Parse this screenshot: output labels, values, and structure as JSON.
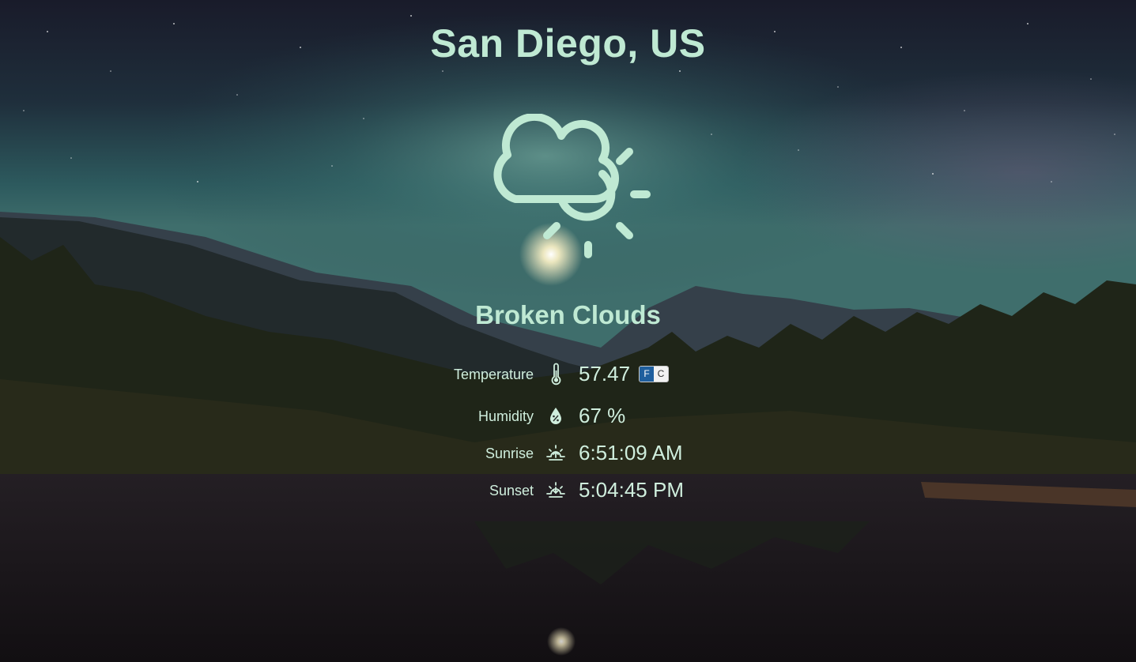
{
  "location": {
    "city_label": "San Diego, US"
  },
  "condition": {
    "label": "Broken Clouds",
    "icon": "cloud-sun-icon"
  },
  "colors": {
    "accent": "#bfe9d3",
    "toggle_active": "#1f5f9e",
    "toggle_inactive": "#f2f2f2"
  },
  "stats": {
    "temperature": {
      "label": "Temperature",
      "value": "57.47",
      "icon": "thermometer-icon"
    },
    "humidity": {
      "label": "Humidity",
      "value": "67 %",
      "icon": "humidity-icon"
    },
    "sunrise": {
      "label": "Sunrise",
      "value": "6:51:09 AM",
      "icon": "sunrise-icon"
    },
    "sunset": {
      "label": "Sunset",
      "value": "5:04:45 PM",
      "icon": "sunset-icon"
    }
  },
  "units": {
    "fahrenheit": "F",
    "celsius": "C",
    "selected": "F"
  }
}
